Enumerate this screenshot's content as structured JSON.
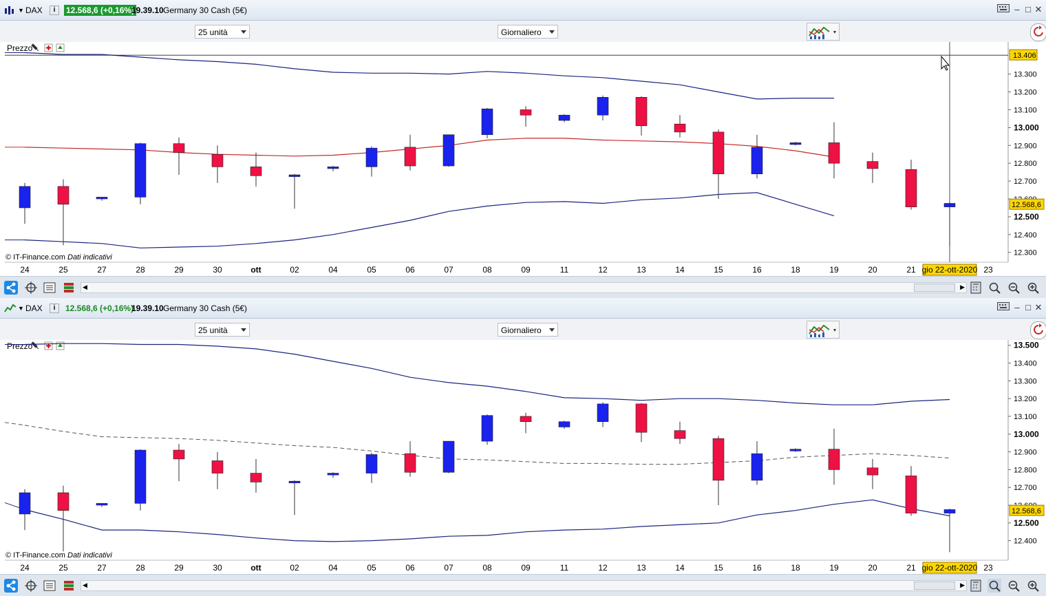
{
  "colors": {
    "bull": "#1a22ee",
    "bear": "#ee1144",
    "band": "#1a237e",
    "mid_red": "#c62828",
    "mid_dash": "#555555",
    "price_label": "#ffd700",
    "grid_line": "#000000"
  },
  "icons": [
    "chart-type-icon",
    "dropdown-arrow-icon",
    "info-icon",
    "keyboard-icon",
    "minimize-icon",
    "maximize-icon",
    "close-icon",
    "wrench-icon",
    "remove-indicator-icon",
    "add-indicator-icon",
    "indicators-icon",
    "share-icon",
    "cursor-icon",
    "mode-icon",
    "bars-icon",
    "scroll-left-icon",
    "scroll-right-icon",
    "calculator-icon",
    "zoom-box-icon",
    "zoom-out-icon",
    "zoom-in-icon",
    "refresh-icon"
  ],
  "panels": [
    {
      "symbol": "DAX",
      "price": "12.568,6 (+0,16%)",
      "time": "19.39.10",
      "instrument": "Germany 30 Cash (5€)",
      "units_select": "25 unità",
      "period_select": "Giornaliero",
      "price_label": "Prezzo",
      "copyright": "© IT-Finance.com",
      "disclaimer": "Dati indicativi",
      "last_price_label": "12.568,6",
      "crosshair_label": "13.406",
      "crosshair_date": "gio 22-ott-2020"
    },
    {
      "symbol": "DAX",
      "price": "12.568,6 (+0,16%)",
      "time": "19.39.10",
      "instrument": "Germany 30 Cash (5€)",
      "units_select": "25 unità",
      "period_select": "Giornaliero",
      "price_label": "Prezzo",
      "copyright": "© IT-Finance.com",
      "disclaimer": "Dati indicativi",
      "last_price_label": "12.568,6",
      "crosshair_date": "gio 22-ott-2020"
    }
  ],
  "chart_data": [
    {
      "type": "candlestick",
      "title": "DAX",
      "x_labels": [
        "24",
        "25",
        "27",
        "28",
        "29",
        "30",
        "ott",
        "02",
        "04",
        "05",
        "06",
        "07",
        "08",
        "09",
        "11",
        "12",
        "13",
        "14",
        "15",
        "16",
        "18",
        "19",
        "20",
        "21",
        "gio 22-ott-2020",
        "23"
      ],
      "y_ticks": [
        "13.300",
        "13.200",
        "13.100",
        "13.000",
        "12.900",
        "12.800",
        "12.700",
        "12.600",
        "12.500",
        "12.400",
        "12.300"
      ],
      "bold_ticks": [
        "13.000",
        "12.500"
      ],
      "ylim": [
        12245,
        13480
      ],
      "candles": [
        {
          "open": 12550,
          "high": 12690,
          "low": 12460,
          "close": 12670
        },
        {
          "open": 12670,
          "high": 12710,
          "low": 12340,
          "close": 12570
        },
        {
          "open": 12600,
          "high": 12610,
          "low": 12590,
          "close": 12610
        },
        {
          "open": 12610,
          "high": 12915,
          "low": 12570,
          "close": 12910
        },
        {
          "open": 12910,
          "high": 12945,
          "low": 12735,
          "close": 12860
        },
        {
          "open": 12850,
          "high": 12900,
          "low": 12690,
          "close": 12780
        },
        {
          "open": 12780,
          "high": 12860,
          "low": 12670,
          "close": 12730
        },
        {
          "open": 12725,
          "high": 12740,
          "low": 12545,
          "close": 12735
        },
        {
          "open": 12770,
          "high": 12785,
          "low": 12755,
          "close": 12780
        },
        {
          "open": 12780,
          "high": 12895,
          "low": 12725,
          "close": 12885
        },
        {
          "open": 12890,
          "high": 12960,
          "low": 12760,
          "close": 12785
        },
        {
          "open": 12785,
          "high": 12960,
          "low": 12780,
          "close": 12960
        },
        {
          "open": 12960,
          "high": 13110,
          "low": 12940,
          "close": 13105
        },
        {
          "open": 13100,
          "high": 13120,
          "low": 13005,
          "close": 13070
        },
        {
          "open": 13040,
          "high": 13075,
          "low": 13030,
          "close": 13070
        },
        {
          "open": 13070,
          "high": 13180,
          "low": 13040,
          "close": 13170
        },
        {
          "open": 13170,
          "high": 13175,
          "low": 12955,
          "close": 13010
        },
        {
          "open": 13020,
          "high": 13070,
          "low": 12945,
          "close": 12975
        },
        {
          "open": 12975,
          "high": 12990,
          "low": 12600,
          "close": 12740
        },
        {
          "open": 12740,
          "high": 12960,
          "low": 12715,
          "close": 12890
        },
        {
          "open": 12905,
          "high": 12920,
          "low": 12900,
          "close": 12915
        },
        {
          "open": 12915,
          "high": 13030,
          "low": 12715,
          "close": 12800
        },
        {
          "open": 12810,
          "high": 12860,
          "low": 12690,
          "close": 12770
        },
        {
          "open": 12765,
          "high": 12820,
          "low": 12540,
          "close": 12555
        },
        {
          "open": 12555,
          "high": 12580,
          "low": 12335,
          "close": 12575
        }
      ],
      "upper_band": [
        13420,
        13410,
        13410,
        13395,
        13380,
        13370,
        13355,
        13330,
        13310,
        13305,
        13305,
        13300,
        13315,
        13305,
        13290,
        13280,
        13260,
        13240,
        13200,
        13160,
        13165,
        13165
      ],
      "middle_line": [
        12890,
        12885,
        12880,
        12875,
        12860,
        12850,
        12845,
        12840,
        12845,
        12860,
        12880,
        12900,
        12930,
        12940,
        12940,
        12930,
        12925,
        12920,
        12910,
        12895,
        12870,
        12835
      ],
      "lower_band": [
        12370,
        12360,
        12350,
        12325,
        12330,
        12335,
        12350,
        12370,
        12400,
        12440,
        12480,
        12530,
        12560,
        12580,
        12585,
        12575,
        12595,
        12605,
        12625,
        12635,
        12570,
        12505
      ],
      "crosshair_y": 13406,
      "last_price": 12568.6
    },
    {
      "type": "candlestick",
      "title": "DAX",
      "x_labels": [
        "24",
        "25",
        "27",
        "28",
        "29",
        "30",
        "ott",
        "02",
        "04",
        "05",
        "06",
        "07",
        "08",
        "09",
        "11",
        "12",
        "13",
        "14",
        "15",
        "16",
        "18",
        "19",
        "20",
        "21",
        "gio 22-ott-2020",
        "23"
      ],
      "y_ticks": [
        "13.500",
        "13.400",
        "13.300",
        "13.200",
        "13.100",
        "13.000",
        "12.900",
        "12.800",
        "12.700",
        "12.600",
        "12.500",
        "12.400"
      ],
      "bold_ticks": [
        "13.500",
        "13.000",
        "12.500"
      ],
      "ylim": [
        12290,
        13530
      ],
      "candles": [
        {
          "open": 12550,
          "high": 12690,
          "low": 12460,
          "close": 12670
        },
        {
          "open": 12670,
          "high": 12710,
          "low": 12340,
          "close": 12570
        },
        {
          "open": 12600,
          "high": 12610,
          "low": 12590,
          "close": 12610
        },
        {
          "open": 12610,
          "high": 12915,
          "low": 12570,
          "close": 12910
        },
        {
          "open": 12910,
          "high": 12945,
          "low": 12735,
          "close": 12860
        },
        {
          "open": 12850,
          "high": 12900,
          "low": 12690,
          "close": 12780
        },
        {
          "open": 12780,
          "high": 12860,
          "low": 12670,
          "close": 12730
        },
        {
          "open": 12725,
          "high": 12740,
          "low": 12545,
          "close": 12735
        },
        {
          "open": 12770,
          "high": 12785,
          "low": 12755,
          "close": 12780
        },
        {
          "open": 12780,
          "high": 12895,
          "low": 12725,
          "close": 12885
        },
        {
          "open": 12890,
          "high": 12960,
          "low": 12760,
          "close": 12785
        },
        {
          "open": 12785,
          "high": 12960,
          "low": 12780,
          "close": 12960
        },
        {
          "open": 12960,
          "high": 13110,
          "low": 12940,
          "close": 13105
        },
        {
          "open": 13100,
          "high": 13120,
          "low": 13005,
          "close": 13070
        },
        {
          "open": 13040,
          "high": 13075,
          "low": 13030,
          "close": 13070
        },
        {
          "open": 13070,
          "high": 13180,
          "low": 13040,
          "close": 13170
        },
        {
          "open": 13170,
          "high": 13175,
          "low": 12955,
          "close": 13010
        },
        {
          "open": 13020,
          "high": 13070,
          "low": 12945,
          "close": 12975
        },
        {
          "open": 12975,
          "high": 12990,
          "low": 12600,
          "close": 12740
        },
        {
          "open": 12740,
          "high": 12960,
          "low": 12715,
          "close": 12890
        },
        {
          "open": 12905,
          "high": 12920,
          "low": 12900,
          "close": 12915
        },
        {
          "open": 12915,
          "high": 13030,
          "low": 12715,
          "close": 12800
        },
        {
          "open": 12810,
          "high": 12860,
          "low": 12690,
          "close": 12770
        },
        {
          "open": 12765,
          "high": 12820,
          "low": 12540,
          "close": 12555
        },
        {
          "open": 12555,
          "high": 12580,
          "low": 12335,
          "close": 12575
        }
      ],
      "upper_band": [
        13505,
        13510,
        13510,
        13505,
        13505,
        13495,
        13480,
        13450,
        13410,
        13370,
        13320,
        13290,
        13270,
        13240,
        13205,
        13200,
        13190,
        13200,
        13200,
        13190,
        13175,
        13165,
        13165,
        13185,
        13195
      ],
      "middle_line": [
        13050,
        13015,
        12985,
        12980,
        12975,
        12965,
        12950,
        12935,
        12925,
        12905,
        12880,
        12860,
        12855,
        12845,
        12835,
        12835,
        12830,
        12830,
        12840,
        12850,
        12870,
        12880,
        12890,
        12880,
        12865
      ],
      "lower_band": [
        12575,
        12520,
        12460,
        12460,
        12450,
        12435,
        12415,
        12400,
        12395,
        12400,
        12410,
        12425,
        12430,
        12450,
        12460,
        12465,
        12480,
        12490,
        12500,
        12545,
        12570,
        12605,
        12630,
        12580,
        12540
      ]
    }
  ]
}
